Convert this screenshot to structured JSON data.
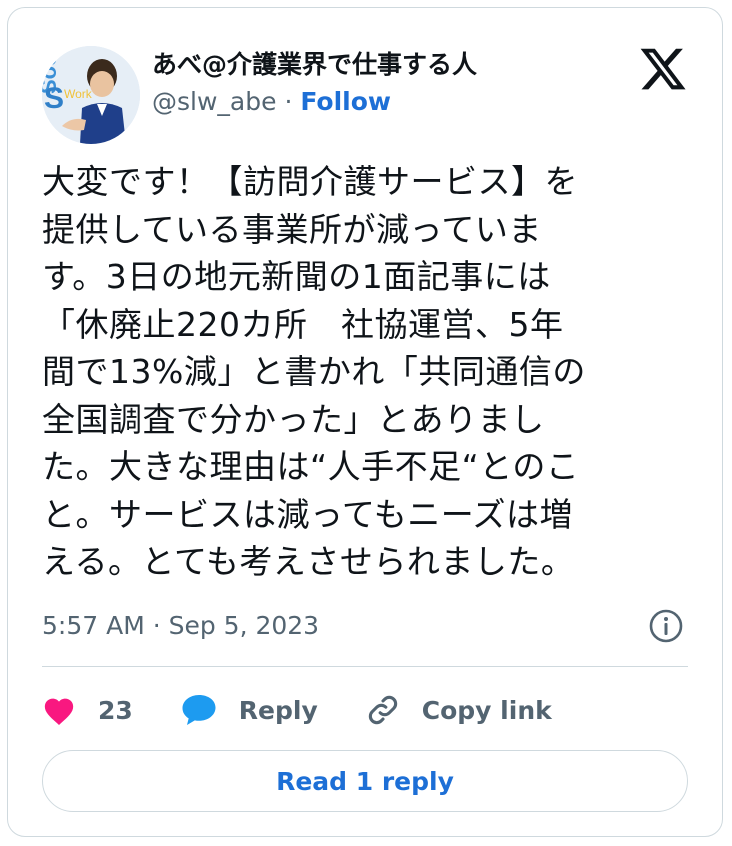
{
  "author": {
    "display_name": "あべ@介護業界で仕事する人",
    "handle": "@slw_abe",
    "separator": " · ",
    "follow_label": "Follow"
  },
  "tweet": {
    "text": "大変です！【訪問介護サービス】を\n提供している事業所が減っていま\nす。3日の地元新聞の1面記事には\n「休廃止220カ所　社協運営、5年\n間で13%減」と書かれ「共同通信の\n全国調査で分かった」とありまし\nた。大きな理由は“人手不足“とのこ\nと。サービスは減ってもニーズは増\nえる。とても考えさせられました。",
    "timestamp": "5:57 AM · Sep 5, 2023"
  },
  "actions": {
    "like_count": "23",
    "reply_label": "Reply",
    "copy_link_label": "Copy link"
  },
  "read_replies_label": "Read 1 reply",
  "icons": {
    "logo": "x-logo-icon",
    "like": "heart-icon",
    "reply": "speech-bubble-icon",
    "copy": "link-icon",
    "info": "info-icon"
  },
  "colors": {
    "like": "#f91880",
    "reply": "#1d9bf0",
    "link_blue": "#1d6fd6",
    "muted": "#536471",
    "border": "#cfd9de"
  }
}
